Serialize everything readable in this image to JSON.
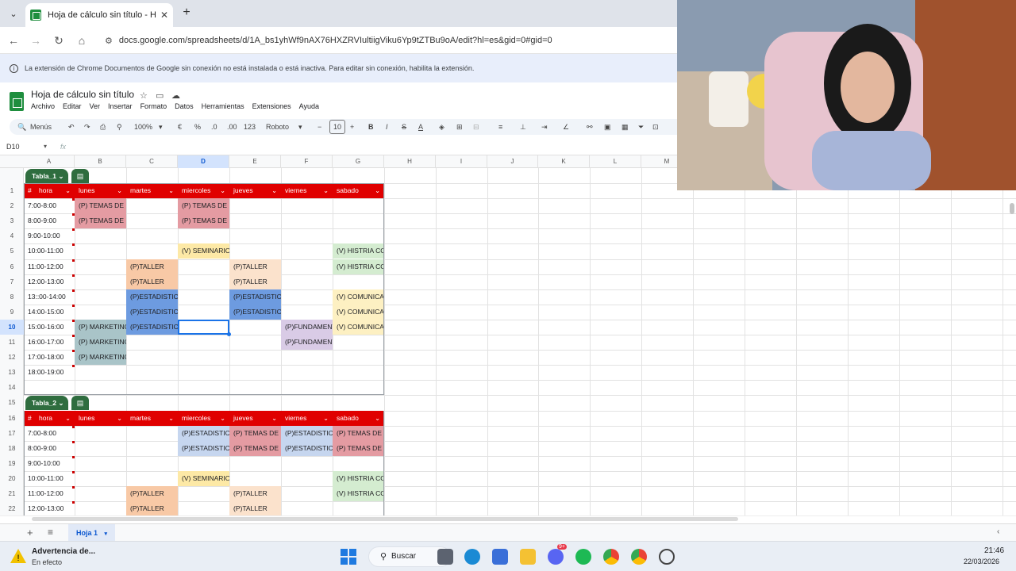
{
  "browser": {
    "tab_title": "Hoja de cálculo sin título - Hoja",
    "url": "docs.google.com/spreadsheets/d/1A_bs1yhWf9nAX76HXZRVIultiigViku6Yp9tZTBu9oA/edit?hl=es&gid=0#gid=0"
  },
  "infobar": {
    "text": "La extensión de Chrome Documentos de Google sin conexión no está instalada o está inactiva. Para editar sin conexión, habilita la extensión."
  },
  "doc": {
    "title": "Hoja de cálculo sin título",
    "menus": [
      "Archivo",
      "Editar",
      "Ver",
      "Insertar",
      "Formato",
      "Datos",
      "Herramientas",
      "Extensiones",
      "Ayuda"
    ]
  },
  "toolbar": {
    "menus_label": "Menús",
    "zoom": "100%",
    "currency": "€",
    "percent": "%",
    "dec_less": ".0",
    "dec_more": ".00",
    "number_format": "123",
    "font": "Roboto",
    "font_size": "10"
  },
  "formula": {
    "name_box": "D10",
    "fx": "fx"
  },
  "columns": [
    "A",
    "B",
    "C",
    "D",
    "E",
    "F",
    "G",
    "H",
    "I",
    "J",
    "K",
    "L",
    "M"
  ],
  "rows": [
    "1",
    "2",
    "3",
    "4",
    "5",
    "6",
    "7",
    "8",
    "9",
    "10",
    "11",
    "12",
    "13",
    "14",
    "15",
    "16",
    "17",
    "18",
    "19",
    "20",
    "21",
    "22"
  ],
  "table1": {
    "name": "Tabla_1",
    "headers": [
      "#",
      "hora",
      "lunes",
      "martes",
      "miercoles",
      "jueves",
      "viernes",
      "sabado"
    ],
    "times": [
      "7:00-8:00",
      "8:00-9:00",
      "9:00-10:00",
      "10:00-11:00",
      "11:00-12:00",
      "12:00-13:00",
      "13::00-14:00",
      "14:00-15:00",
      "15:00-16:00",
      "16:00-17:00",
      "17:00-18:00",
      "18:00-19:00"
    ]
  },
  "table2": {
    "name": "Tabla_2",
    "headers": [
      "#",
      "hora",
      "lunes",
      "martes",
      "miercoles",
      "jueves",
      "viernes",
      "sabado"
    ],
    "times": [
      "7:00-8:00",
      "8:00-9:00",
      "9:00-10:00",
      "10:00-11:00",
      "11:00-12:00",
      "12:00-13:00"
    ]
  },
  "classes": {
    "temas": "(P) TEMAS DE H",
    "temas2": "(P) TEMAS DE I",
    "seminario": "(V) SEMINARIO",
    "historia": "(V) HISTRIA CO",
    "taller": "(P)TALLER",
    "estadistica": "(P)ESTADISTIC/",
    "estadistica2": "(P)ESTADISTICA",
    "comunicacion": "(V) COMUNICAC",
    "marketing": "(P) MARKETINC",
    "fundamentos": "(P)FUNDAMENT"
  },
  "sheets": {
    "tab": "Hoja 1",
    "add": "+",
    "list": "≡"
  },
  "taskbar": {
    "notif_title": "Advertencia de...",
    "notif_sub": "En efecto",
    "search": "Buscar",
    "time": "21:46",
    "date": "22/03/2026",
    "badge": "9+"
  }
}
